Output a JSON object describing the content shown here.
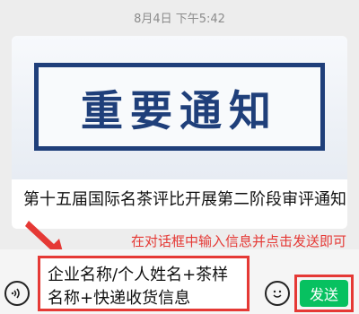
{
  "chat": {
    "timestamp": "8月4日 下午5:42"
  },
  "article_card": {
    "banner_text": "重要通知",
    "title": "第十五届国际名茶评比开展第二阶段审评通知"
  },
  "annotation": {
    "instruction": "在对话框中输入信息并点击发送即可"
  },
  "composer": {
    "input_value": "企业名称/个人姓名+茶样名称+快递收货信息",
    "send_label": "发送"
  },
  "colors": {
    "highlight": "#e53935",
    "send_green": "#07c160",
    "banner_blue": "#1f3f7a"
  },
  "icons": {
    "voice": "voice-icon",
    "emoji": "emoji-icon",
    "arrow": "annotation-arrow-icon"
  }
}
